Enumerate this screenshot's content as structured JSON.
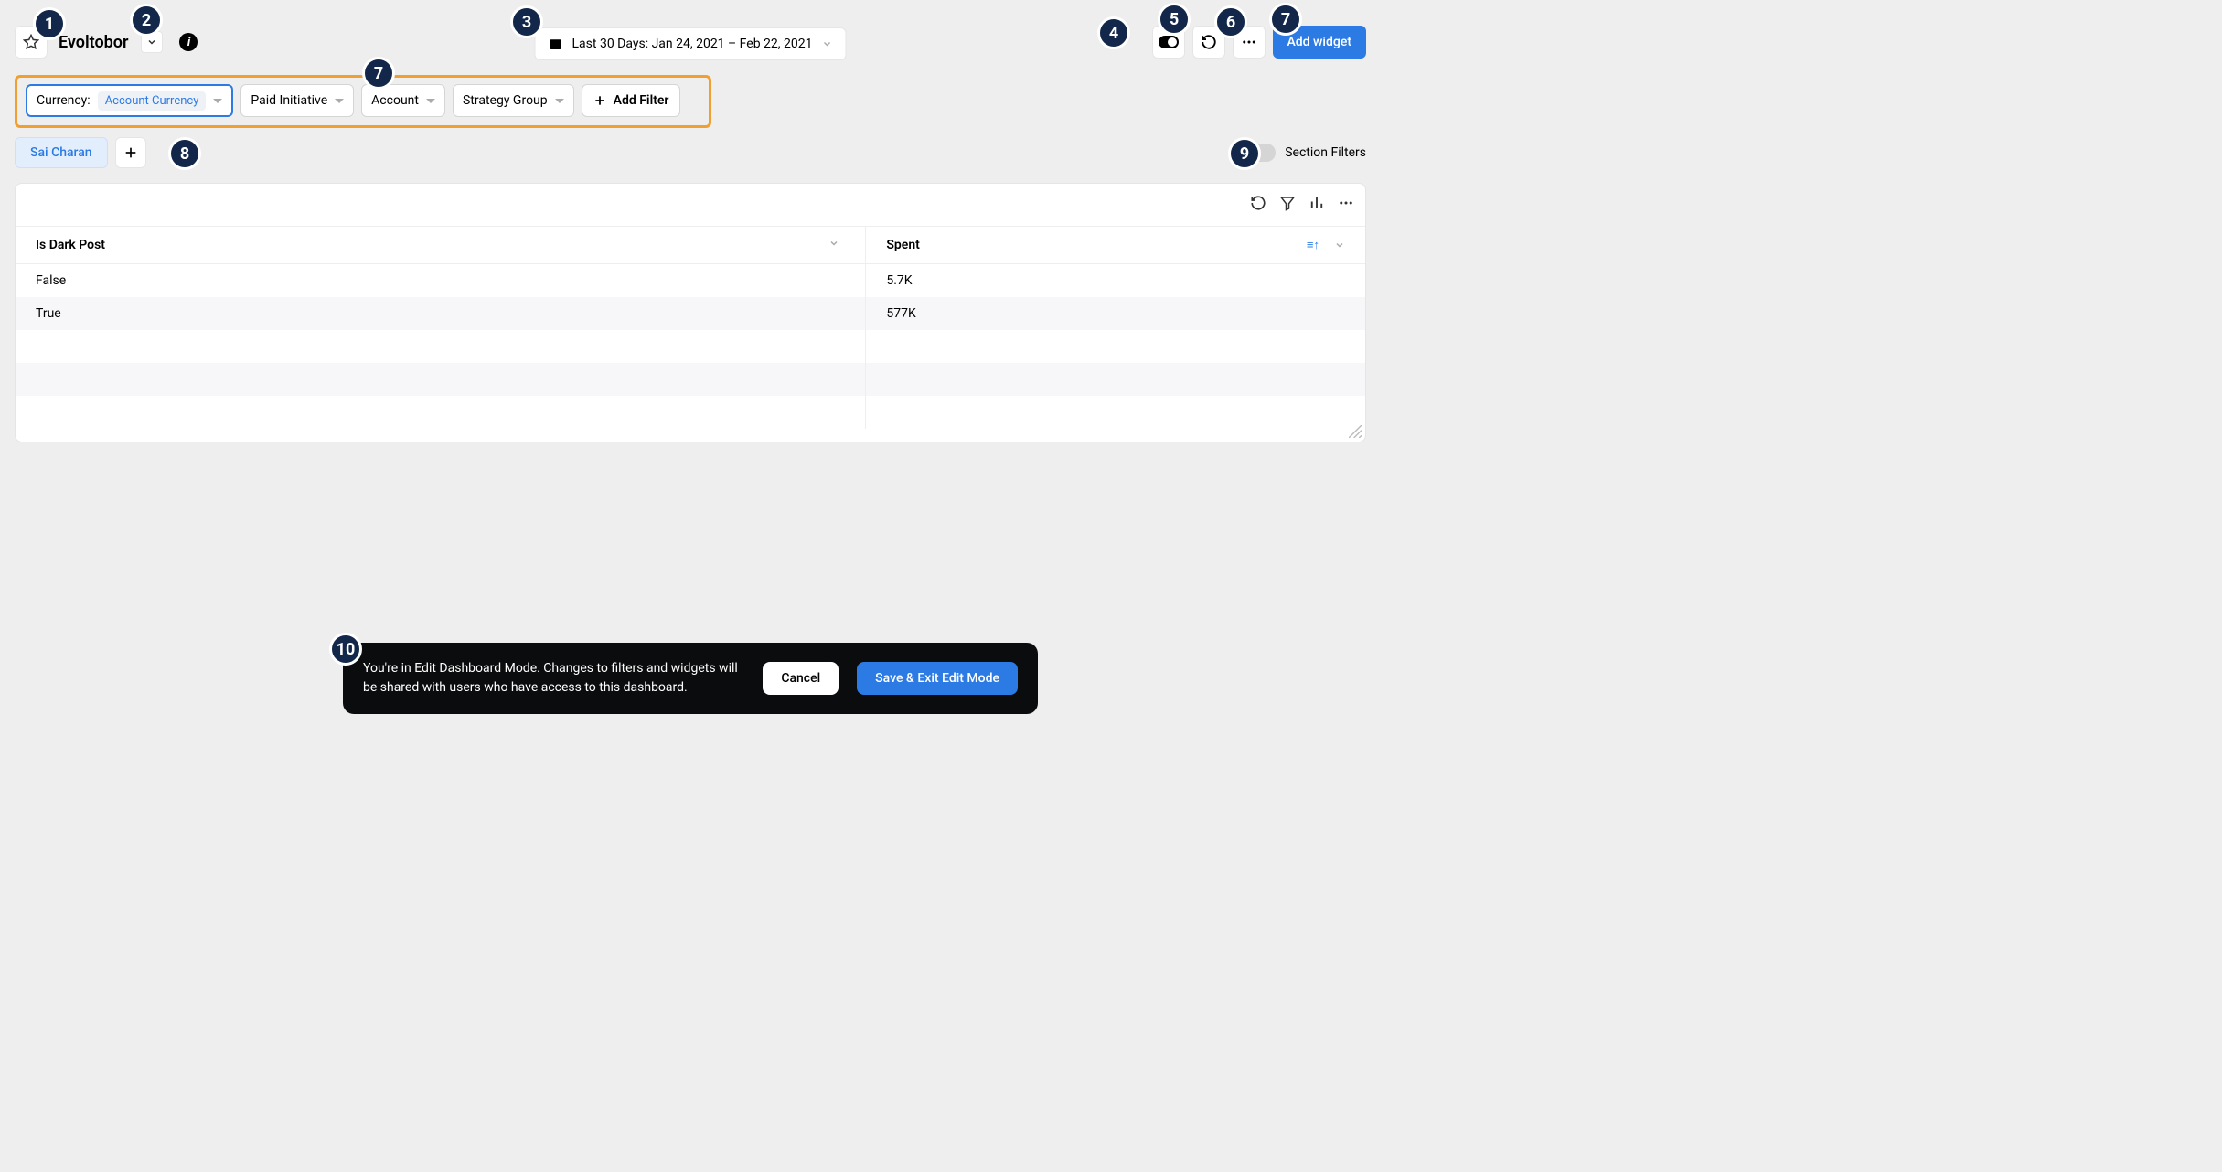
{
  "header": {
    "title": "Evoltobor",
    "date_range": "Last 30 Days: Jan 24, 2021 – Feb 22, 2021",
    "add_widget_label": "Add widget"
  },
  "filters": {
    "currency_label": "Currency:",
    "currency_value": "Account Currency",
    "items": [
      "Paid Initiative",
      "Account",
      "Strategy Group"
    ],
    "add_filter_label": "Add Filter"
  },
  "section": {
    "tab_label": "Sai Charan",
    "section_filters_label": "Section Filters"
  },
  "table": {
    "columns": [
      "Is Dark Post",
      "Spent"
    ],
    "rows": [
      {
        "is_dark_post": "False",
        "spent": "5.7K"
      },
      {
        "is_dark_post": "True",
        "spent": "577K"
      }
    ]
  },
  "toast": {
    "text": "You're in Edit Dashboard Mode. Changes to filters and widgets will be shared with users who have access to this dashboard.",
    "cancel": "Cancel",
    "save": "Save & Exit Edit Mode"
  },
  "callouts": {
    "c1": "1",
    "c2": "2",
    "c3": "3",
    "c4": "4",
    "c5": "5",
    "c6": "6",
    "c7a": "7",
    "c7b": "7",
    "c8": "8",
    "c9": "9",
    "c10": "10"
  }
}
